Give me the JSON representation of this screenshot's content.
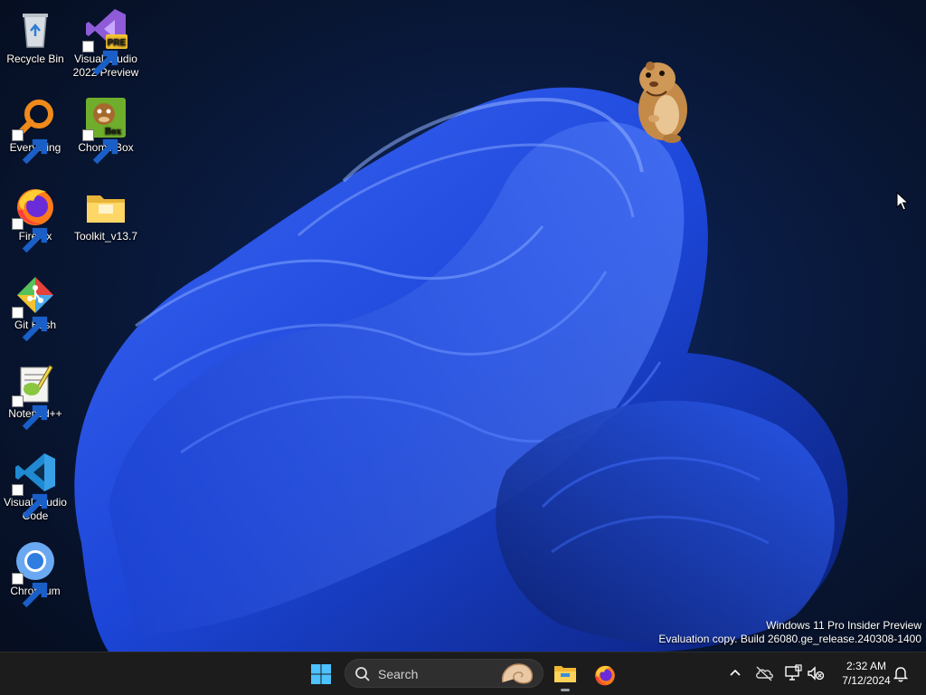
{
  "desktop": {
    "icons": [
      {
        "label": "Recycle Bin",
        "icon": "recycle-bin-icon",
        "shortcut": false
      },
      {
        "label": "Visual Studio 2022 Preview",
        "icon": "visual-studio-preview-icon",
        "shortcut": true,
        "badge": "PRE"
      },
      {
        "label": "Everything",
        "icon": "everything-search-icon",
        "shortcut": true
      },
      {
        "label": "ChomikBox",
        "icon": "chomikbox-icon",
        "shortcut": true,
        "badge": "Box"
      },
      {
        "label": "Firefox",
        "icon": "firefox-icon",
        "shortcut": true
      },
      {
        "label": "Toolkit_v13.7",
        "icon": "folder-icon",
        "shortcut": false
      },
      {
        "label": "Git Bash",
        "icon": "git-bash-icon",
        "shortcut": true
      },
      {
        "label": "Notepad++",
        "icon": "notepad-plus-plus-icon",
        "shortcut": true
      },
      {
        "label": "Visual Studio Code",
        "icon": "vscode-icon",
        "shortcut": true
      },
      {
        "label": "Chromium",
        "icon": "chromium-icon",
        "shortcut": true
      }
    ],
    "watermark_line1": "Windows 11 Pro Insider Preview",
    "watermark_line2": "Evaluation copy. Build 26080.ge_release.240308-1400"
  },
  "taskbar": {
    "start_icon": "windows-start-icon",
    "search_label": "Search",
    "pinned": [
      {
        "name": "File Explorer",
        "icon": "file-explorer-icon",
        "running": true
      },
      {
        "name": "Firefox",
        "icon": "firefox-icon",
        "running": false
      }
    ],
    "tray": [
      "chevron-up-icon",
      "onedrive-offline-icon",
      "network-icon",
      "volume-muted-icon"
    ],
    "time": "2:32 AM",
    "date": "7/12/2024",
    "notification_icon": "bell-icon"
  },
  "colors": {
    "desktop_background": "#0a1c44",
    "wallpaper_bloom": "#1e4ee0",
    "taskbar_background": "#1c1c1c",
    "windows_logo": "#4cc2ff"
  }
}
